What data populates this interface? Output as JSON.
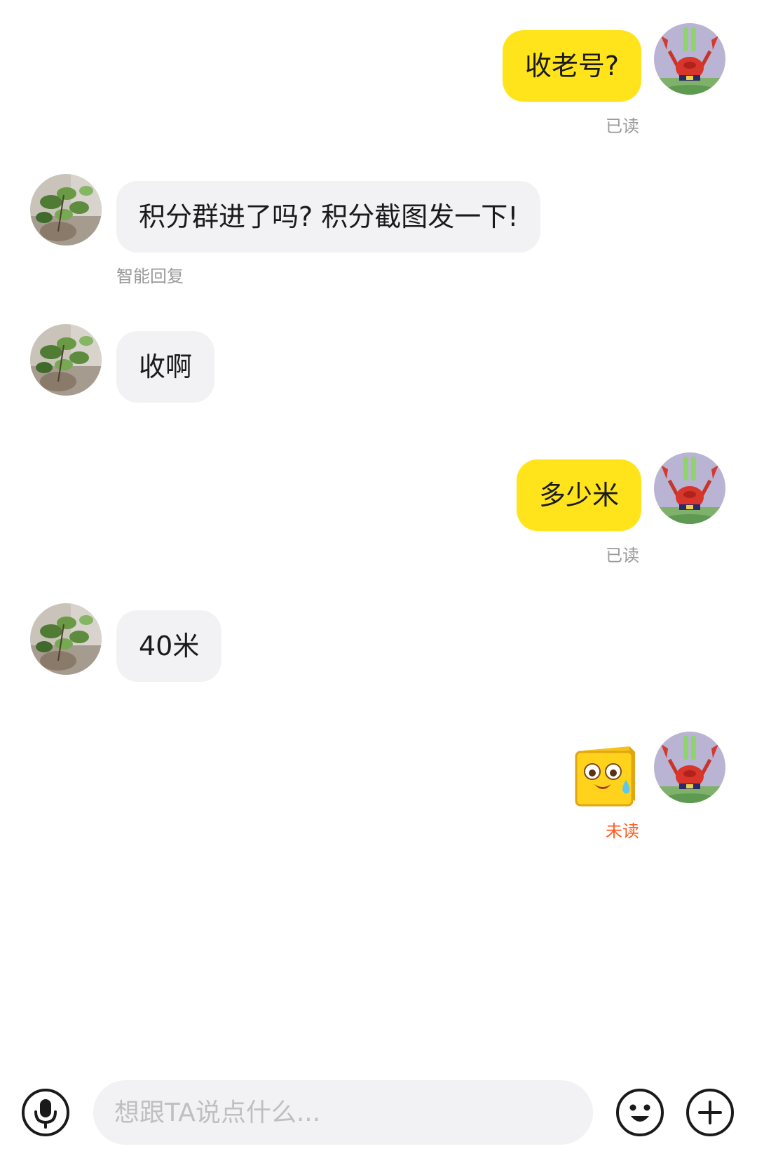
{
  "messages": [
    {
      "sender": "me",
      "type": "text",
      "text": "收老号?",
      "status": "已读"
    },
    {
      "sender": "them",
      "type": "text",
      "text": "积分群进了吗? 积分截图发一下!",
      "caption": "智能回复"
    },
    {
      "sender": "them",
      "type": "text",
      "text": "收啊"
    },
    {
      "sender": "me",
      "type": "text",
      "text": "多少米",
      "status": "已读"
    },
    {
      "sender": "them",
      "type": "text",
      "text": "40米"
    },
    {
      "sender": "me",
      "type": "sticker",
      "sticker": "crying-yellow-block-emoji",
      "status": "未读"
    }
  ],
  "input_bar": {
    "placeholder": "想跟TA说点什么...",
    "voice_icon": "microphone-icon",
    "emoji_icon": "smiley-icon",
    "more_icon": "plus-icon"
  },
  "colors": {
    "my_bubble": "#ffe41c",
    "their_bubble": "#f2f2f4",
    "unread_status": "#ff5a1f",
    "read_status": "#9a9a9a"
  }
}
